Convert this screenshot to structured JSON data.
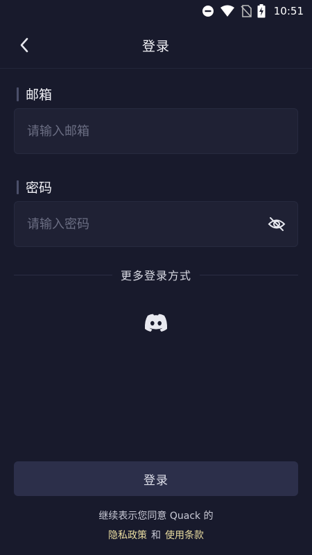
{
  "status_bar": {
    "time": "10:51"
  },
  "header": {
    "title": "登录"
  },
  "form": {
    "email": {
      "label": "邮箱",
      "placeholder": "请输入邮箱",
      "value": ""
    },
    "password": {
      "label": "密码",
      "placeholder": "请输入密码",
      "value": ""
    }
  },
  "more_login": {
    "text": "更多登录方式",
    "providers": [
      {
        "icon": "discord-icon"
      }
    ]
  },
  "login_button": {
    "label": "登录"
  },
  "footer": {
    "agree_text": "继续表示您同意 Quack 的",
    "privacy_label": "隐私政策",
    "and_label": "和",
    "terms_label": "使用条款"
  },
  "colors": {
    "background": "#181a2c",
    "input_bg": "#1f2134",
    "button_bg": "#2c2f4a",
    "link": "#e9dca0"
  }
}
